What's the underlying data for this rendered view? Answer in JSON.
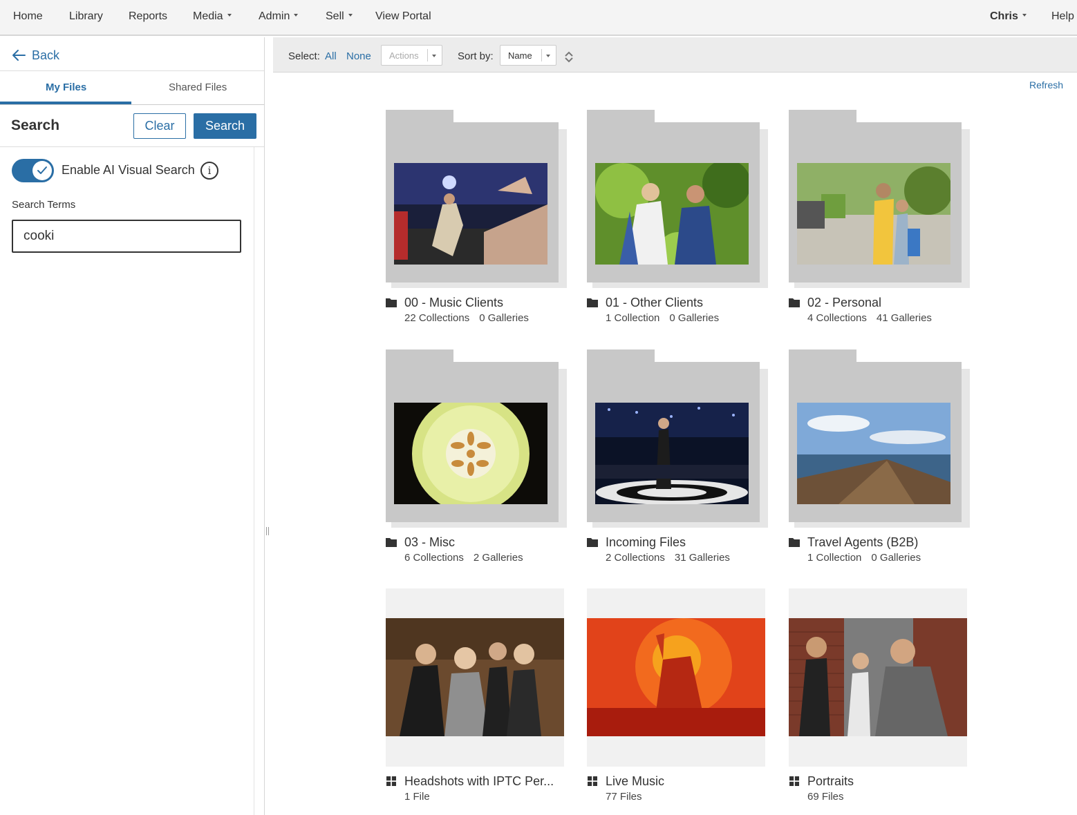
{
  "nav": {
    "home": "Home",
    "library": "Library",
    "reports": "Reports",
    "media": "Media",
    "admin": "Admin",
    "sell": "Sell",
    "view_portal": "View Portal",
    "user": "Chris",
    "help": "Help"
  },
  "sidebar": {
    "back": "Back",
    "tabs": {
      "my_files": "My Files",
      "shared_files": "Shared Files"
    },
    "search_title": "Search",
    "clear_label": "Clear",
    "search_label": "Search",
    "ai_toggle_label": "Enable AI Visual Search",
    "ai_toggle_on": true,
    "info_glyph": "i",
    "search_terms_label": "Search Terms",
    "search_terms_value": "cooki"
  },
  "toolbar": {
    "select_label": "Select:",
    "all": "All",
    "none": "None",
    "actions": "Actions",
    "sort_label": "Sort by:",
    "sort_value": "Name"
  },
  "main": {
    "refresh": "Refresh",
    "folders": [
      {
        "title": "00 - Music Clients",
        "collections": "22 Collections",
        "galleries": "0 Galleries"
      },
      {
        "title": "01 - Other Clients",
        "collections": "1 Collection",
        "galleries": "0 Galleries"
      },
      {
        "title": "02 - Personal",
        "collections": "4 Collections",
        "galleries": "41 Galleries"
      },
      {
        "title": "03 - Misc",
        "collections": "6 Collections",
        "galleries": "2 Galleries"
      },
      {
        "title": "Incoming Files",
        "collections": "2 Collections",
        "galleries": "31 Galleries"
      },
      {
        "title": "Travel Agents (B2B)",
        "collections": "1 Collection",
        "galleries": "0 Galleries"
      }
    ],
    "galleries": [
      {
        "title": "Headshots with IPTC Per...",
        "files": "1 File"
      },
      {
        "title": "Live Music",
        "files": "77 Files"
      },
      {
        "title": "Portraits",
        "files": "69 Files"
      }
    ]
  },
  "colors": {
    "accent": "#2a6ea5",
    "folder_gray": "#c8c8c8",
    "nav_bg": "#f4f4f4"
  },
  "icons": [
    "arrow-left-icon",
    "check-icon",
    "info-icon",
    "folder-icon",
    "gallery-grid-icon",
    "sort-toggle-icon",
    "caret-down-icon"
  ]
}
